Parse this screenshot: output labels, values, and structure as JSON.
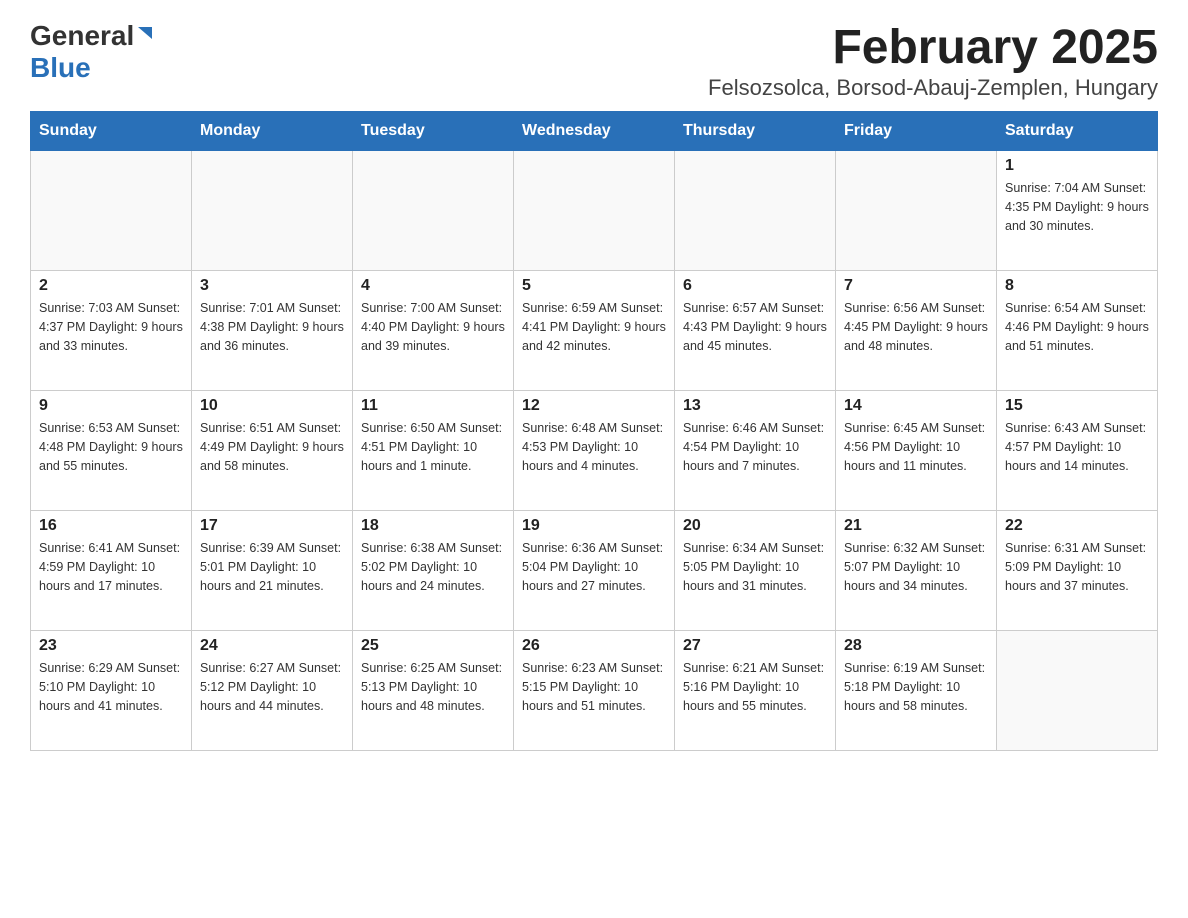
{
  "header": {
    "logo_general": "General",
    "logo_blue": "Blue",
    "month_title": "February 2025",
    "location": "Felsozsolca, Borsod-Abauj-Zemplen, Hungary"
  },
  "days_of_week": [
    "Sunday",
    "Monday",
    "Tuesday",
    "Wednesday",
    "Thursday",
    "Friday",
    "Saturday"
  ],
  "weeks": [
    [
      {
        "day": "",
        "info": ""
      },
      {
        "day": "",
        "info": ""
      },
      {
        "day": "",
        "info": ""
      },
      {
        "day": "",
        "info": ""
      },
      {
        "day": "",
        "info": ""
      },
      {
        "day": "",
        "info": ""
      },
      {
        "day": "1",
        "info": "Sunrise: 7:04 AM\nSunset: 4:35 PM\nDaylight: 9 hours and 30 minutes."
      }
    ],
    [
      {
        "day": "2",
        "info": "Sunrise: 7:03 AM\nSunset: 4:37 PM\nDaylight: 9 hours and 33 minutes."
      },
      {
        "day": "3",
        "info": "Sunrise: 7:01 AM\nSunset: 4:38 PM\nDaylight: 9 hours and 36 minutes."
      },
      {
        "day": "4",
        "info": "Sunrise: 7:00 AM\nSunset: 4:40 PM\nDaylight: 9 hours and 39 minutes."
      },
      {
        "day": "5",
        "info": "Sunrise: 6:59 AM\nSunset: 4:41 PM\nDaylight: 9 hours and 42 minutes."
      },
      {
        "day": "6",
        "info": "Sunrise: 6:57 AM\nSunset: 4:43 PM\nDaylight: 9 hours and 45 minutes."
      },
      {
        "day": "7",
        "info": "Sunrise: 6:56 AM\nSunset: 4:45 PM\nDaylight: 9 hours and 48 minutes."
      },
      {
        "day": "8",
        "info": "Sunrise: 6:54 AM\nSunset: 4:46 PM\nDaylight: 9 hours and 51 minutes."
      }
    ],
    [
      {
        "day": "9",
        "info": "Sunrise: 6:53 AM\nSunset: 4:48 PM\nDaylight: 9 hours and 55 minutes."
      },
      {
        "day": "10",
        "info": "Sunrise: 6:51 AM\nSunset: 4:49 PM\nDaylight: 9 hours and 58 minutes."
      },
      {
        "day": "11",
        "info": "Sunrise: 6:50 AM\nSunset: 4:51 PM\nDaylight: 10 hours and 1 minute."
      },
      {
        "day": "12",
        "info": "Sunrise: 6:48 AM\nSunset: 4:53 PM\nDaylight: 10 hours and 4 minutes."
      },
      {
        "day": "13",
        "info": "Sunrise: 6:46 AM\nSunset: 4:54 PM\nDaylight: 10 hours and 7 minutes."
      },
      {
        "day": "14",
        "info": "Sunrise: 6:45 AM\nSunset: 4:56 PM\nDaylight: 10 hours and 11 minutes."
      },
      {
        "day": "15",
        "info": "Sunrise: 6:43 AM\nSunset: 4:57 PM\nDaylight: 10 hours and 14 minutes."
      }
    ],
    [
      {
        "day": "16",
        "info": "Sunrise: 6:41 AM\nSunset: 4:59 PM\nDaylight: 10 hours and 17 minutes."
      },
      {
        "day": "17",
        "info": "Sunrise: 6:39 AM\nSunset: 5:01 PM\nDaylight: 10 hours and 21 minutes."
      },
      {
        "day": "18",
        "info": "Sunrise: 6:38 AM\nSunset: 5:02 PM\nDaylight: 10 hours and 24 minutes."
      },
      {
        "day": "19",
        "info": "Sunrise: 6:36 AM\nSunset: 5:04 PM\nDaylight: 10 hours and 27 minutes."
      },
      {
        "day": "20",
        "info": "Sunrise: 6:34 AM\nSunset: 5:05 PM\nDaylight: 10 hours and 31 minutes."
      },
      {
        "day": "21",
        "info": "Sunrise: 6:32 AM\nSunset: 5:07 PM\nDaylight: 10 hours and 34 minutes."
      },
      {
        "day": "22",
        "info": "Sunrise: 6:31 AM\nSunset: 5:09 PM\nDaylight: 10 hours and 37 minutes."
      }
    ],
    [
      {
        "day": "23",
        "info": "Sunrise: 6:29 AM\nSunset: 5:10 PM\nDaylight: 10 hours and 41 minutes."
      },
      {
        "day": "24",
        "info": "Sunrise: 6:27 AM\nSunset: 5:12 PM\nDaylight: 10 hours and 44 minutes."
      },
      {
        "day": "25",
        "info": "Sunrise: 6:25 AM\nSunset: 5:13 PM\nDaylight: 10 hours and 48 minutes."
      },
      {
        "day": "26",
        "info": "Sunrise: 6:23 AM\nSunset: 5:15 PM\nDaylight: 10 hours and 51 minutes."
      },
      {
        "day": "27",
        "info": "Sunrise: 6:21 AM\nSunset: 5:16 PM\nDaylight: 10 hours and 55 minutes."
      },
      {
        "day": "28",
        "info": "Sunrise: 6:19 AM\nSunset: 5:18 PM\nDaylight: 10 hours and 58 minutes."
      },
      {
        "day": "",
        "info": ""
      }
    ]
  ]
}
